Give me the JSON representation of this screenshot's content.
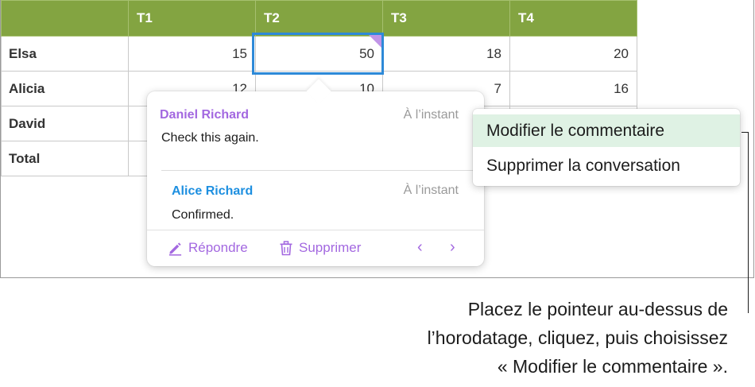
{
  "table": {
    "columns": [
      "T1",
      "T2",
      "T3",
      "T4"
    ],
    "rows": [
      {
        "label": "Elsa",
        "values": [
          "15",
          "50",
          "18",
          "20"
        ]
      },
      {
        "label": "Alicia",
        "values": [
          "12",
          "10",
          "7",
          "16"
        ]
      },
      {
        "label": "David",
        "values": [
          "",
          "",
          "",
          ""
        ]
      },
      {
        "label": "Total",
        "values": [
          "",
          "",
          "",
          ""
        ]
      }
    ],
    "header_color": "#83a441",
    "selected_cell_color": "#2e8ad8"
  },
  "comment_popover": {
    "comments": [
      {
        "author": "Daniel Richard",
        "time": "À l’instant",
        "text": "Check this again.",
        "author_color": "#a368e0"
      },
      {
        "author": "Alice Richard",
        "time": "À l’instant",
        "text": "Confirmed.",
        "author_color": "#1d8fe0"
      }
    ],
    "reply_label": "Répondre",
    "delete_label": "Supprimer",
    "prev_icon": "‹",
    "next_icon": "›",
    "accent_color": "#a368e0"
  },
  "context_menu": {
    "items": [
      "Modifier le commentaire",
      "Supprimer la conversation"
    ],
    "highlight_color": "#dff2e4"
  },
  "callout": {
    "lines": [
      "Placez le pointeur au-dessus de",
      "l’horodatage, cliquez, puis choisissez",
      "« Modifier le commentaire »."
    ]
  }
}
